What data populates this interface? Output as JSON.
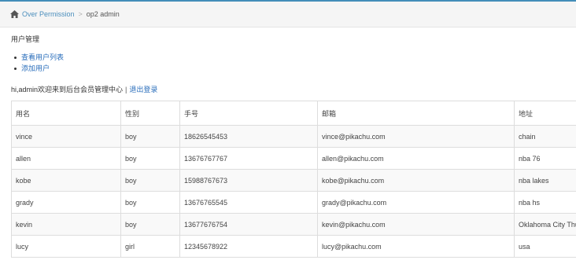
{
  "breadcrumb": {
    "home_label": "Over Permission",
    "separator": ">",
    "current": "op2 admin"
  },
  "section_title": "用户管理",
  "menu": [
    {
      "label": "查看用户列表"
    },
    {
      "label": "添加用户"
    }
  ],
  "welcome": {
    "text": "hi,admin欢迎来到后台会员管理中心",
    "separator": "|",
    "logout": "退出登录"
  },
  "table": {
    "headers": [
      "用名",
      "性别",
      "手号",
      "邮箱",
      "地址"
    ],
    "rows": [
      [
        "vince",
        "boy",
        "18626545453",
        "vince@pikachu.com",
        "chain"
      ],
      [
        "allen",
        "boy",
        "13676767767",
        "allen@pikachu.com",
        "nba 76"
      ],
      [
        "kobe",
        "boy",
        "15988767673",
        "kobe@pikachu.com",
        "nba lakes"
      ],
      [
        "grady",
        "boy",
        "13676765545",
        "grady@pikachu.com",
        "nba hs"
      ],
      [
        "kevin",
        "boy",
        "13677676754",
        "kevin@pikachu.com",
        "Oklahoma City Thun"
      ],
      [
        "lucy",
        "girl",
        "12345678922",
        "lucy@pikachu.com",
        "usa"
      ]
    ]
  },
  "colors": {
    "accent": "#438eb9",
    "link": "#2a6ebb"
  }
}
